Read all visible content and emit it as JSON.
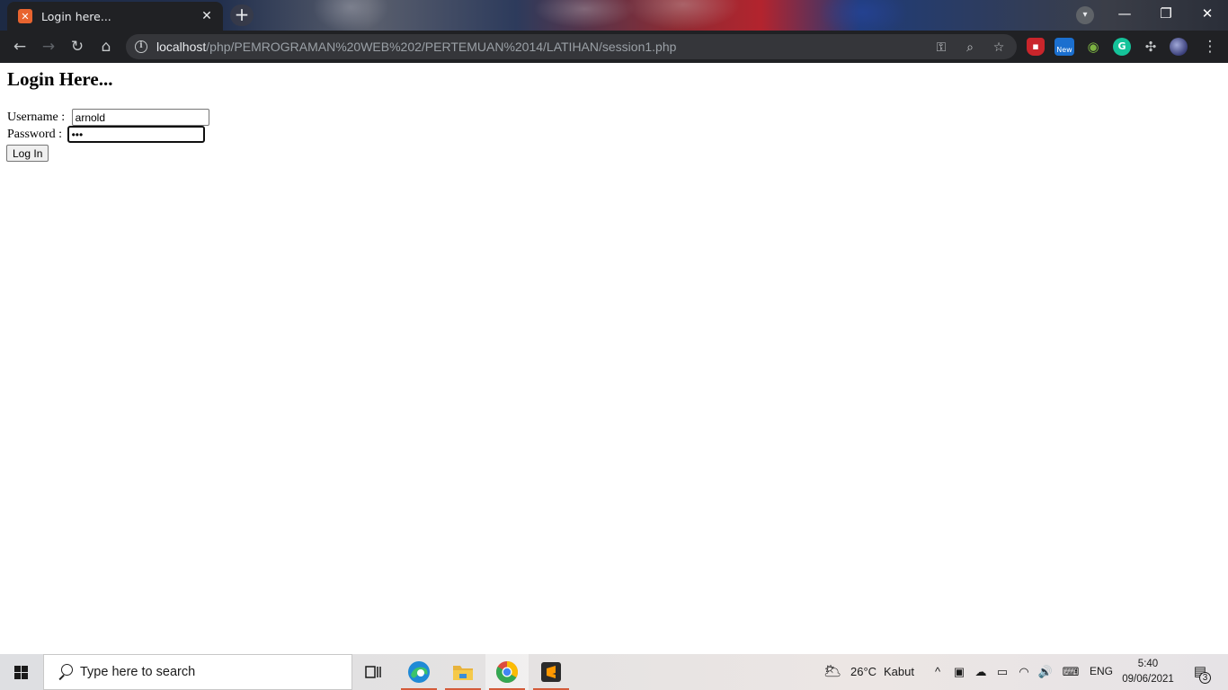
{
  "browser": {
    "tab_title": "Login here...",
    "tab_favicon": "xampp-icon",
    "url_host": "localhost",
    "url_path": "/php/PEMROGRAMAN%20WEB%202/PERTEMUAN%2014/LATIHAN/session1.php",
    "extension_badge": "New"
  },
  "page": {
    "heading": "Login Here...",
    "username_label": "Username : ",
    "username_value": "arnold",
    "password_label": "Password : ",
    "password_value": "•••",
    "login_button": "Log In"
  },
  "taskbar": {
    "search_placeholder": "Type here to search",
    "weather_temp": "26°C",
    "weather_desc": "Kabut",
    "language": "ENG",
    "time": "5:40",
    "date": "09/06/2021",
    "notification_count": "3",
    "accent_color": "#d45b3a"
  }
}
